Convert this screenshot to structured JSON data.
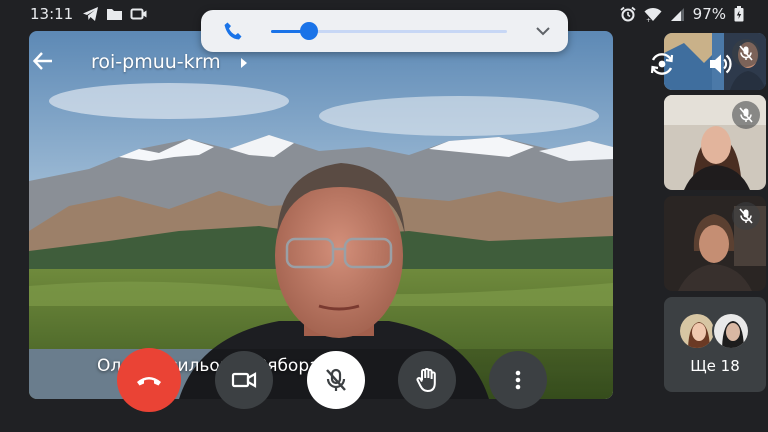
{
  "status_bar": {
    "time": "13:11",
    "battery": "97%",
    "icons_left": [
      "telegram-icon",
      "folder-icon",
      "camera-icon"
    ],
    "icons_right": [
      "alarm-icon",
      "wifi-icon",
      "signal-icon",
      "battery-icon"
    ]
  },
  "volume": {
    "icon": "phone-icon",
    "level_fraction": 0.16,
    "expand_icon": "chevron-down-icon",
    "accent": "#1a73e8"
  },
  "meeting": {
    "title": "roi-pmuu-krm",
    "main_participant_name": "Олег Васильович Зябора"
  },
  "top_controls": {
    "switch_camera_icon": "switch-camera-icon",
    "speaker_icon": "speaker-icon"
  },
  "participants": {
    "thumbnails": [
      {
        "muted": true
      },
      {
        "muted": true
      },
      {
        "muted": true
      }
    ],
    "more_label": "Ще 18"
  },
  "controls": {
    "end_call_icon": "end-call-icon",
    "camera_icon": "video-camera-icon",
    "mic_icon": "mic-off-icon",
    "raise_hand_icon": "raise-hand-icon",
    "more_icon": "more-vert-icon",
    "end_call_color": "#ea4335"
  }
}
